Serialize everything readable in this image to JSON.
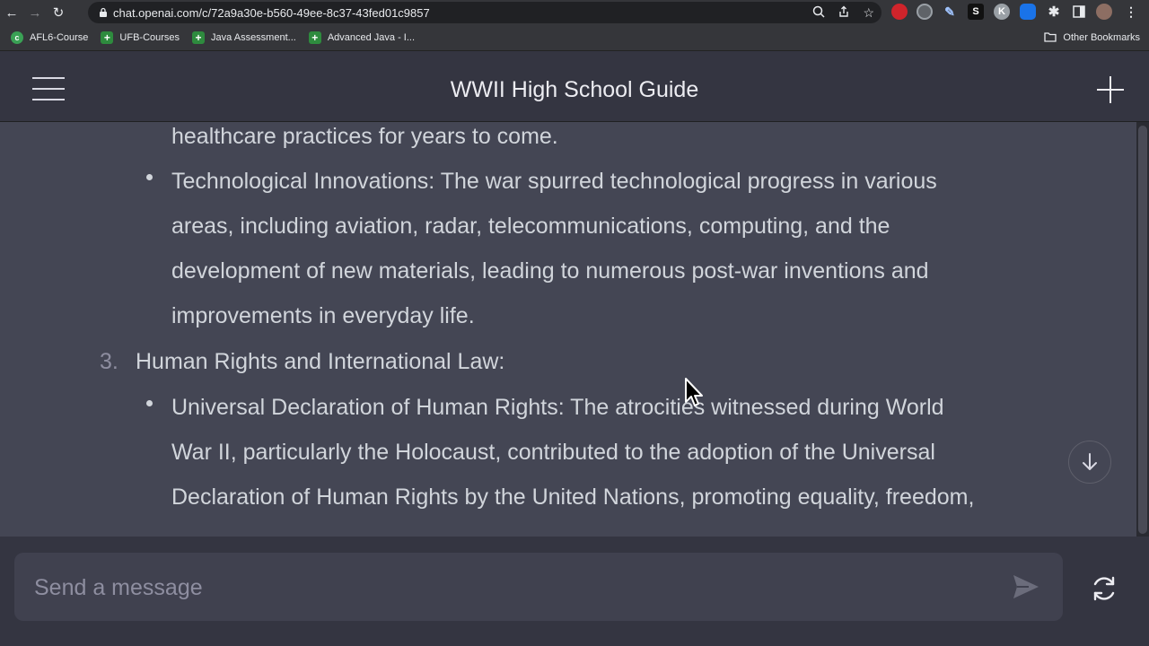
{
  "browser": {
    "url": "chat.openai.com/c/72a9a30e-b560-49ee-8c37-43fed01c9857",
    "bookmarks": [
      "AFL6-Course",
      "UFB-Courses",
      "Java Assessment...",
      "Advanced Java - I..."
    ],
    "other_bookmarks": "Other Bookmarks",
    "extension_letters": {
      "s": "S",
      "k": "K"
    }
  },
  "header": {
    "title": "WWII High School Guide"
  },
  "message": {
    "lines": [
      "healthcare practices for years to come.",
      "Technological Innovations: The war spurred technological progress in various",
      "areas, including aviation, radar, telecommunications, computing, and the",
      "development of new materials, leading to numerous post-war inventions and",
      "improvements in everyday life.",
      "Human Rights and International Law:",
      "Universal Declaration of Human Rights: The atrocities witnessed during World",
      "War II, particularly the Holocaust, contributed to the adoption of the Universal",
      "Declaration of Human Rights by the United Nations, promoting equality, freedom,"
    ],
    "list_number": "3."
  },
  "composer": {
    "placeholder": "Send a message"
  },
  "colors": {
    "background": "#343541",
    "message_bg": "#444654",
    "text": "#d1d5db"
  }
}
